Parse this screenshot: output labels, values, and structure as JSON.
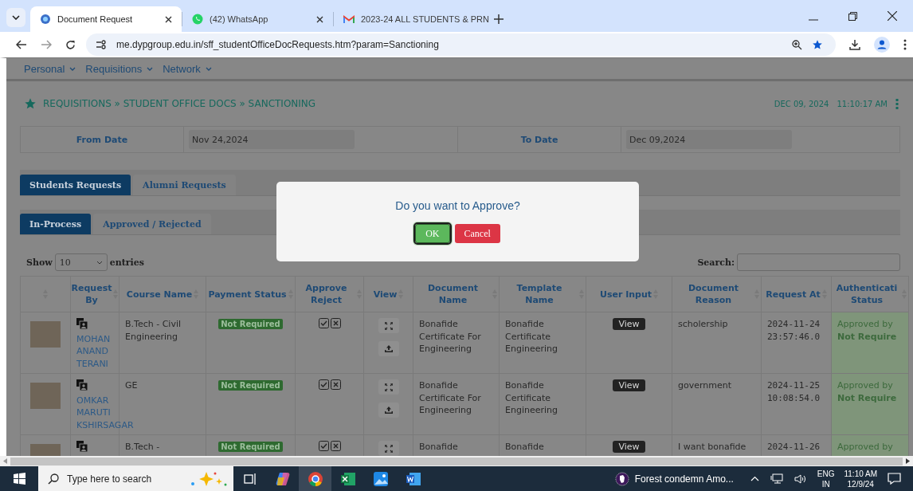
{
  "browser": {
    "tabs": [
      {
        "title": "Document Request",
        "kind": "site",
        "selected": true
      },
      {
        "title": "(42) WhatsApp",
        "kind": "whatsapp",
        "selected": false
      },
      {
        "title": "2023-24 ALL STUDENTS & PRN",
        "kind": "gmail",
        "selected": false
      }
    ],
    "url": "me.dypgroup.edu.in/sff_studentOfficeDocRequests.htm?param=Sanctioning"
  },
  "nav": [
    "Personal",
    "Requisitions",
    "Network"
  ],
  "breadcrumb": "REQUISITIONS » STUDENT OFFICE DOCS » SANCTIONING",
  "date": "DEC 09, 2024",
  "time": "11:10:17 AM",
  "filters": [
    {
      "label": "From Date",
      "value": "Nov 24,2024"
    },
    {
      "label": "To Date",
      "value": "Dec 09,2024"
    }
  ],
  "tabs": [
    {
      "label": "Students Requests",
      "selected": true
    },
    {
      "label": "Alumni Requests",
      "selected": false
    }
  ],
  "subtabs": [
    {
      "label": "In-Process",
      "selected": true
    },
    {
      "label": "Approved / Rejected",
      "selected": false
    }
  ],
  "show_label": "Show",
  "entries_value": "10",
  "entries_label": "entries",
  "search_label": "Search:",
  "table": {
    "columns": [
      "",
      "Request By",
      "Course Name",
      "Payment Status",
      "Approve Reject",
      "View",
      "Document Name",
      "Template Name",
      "User Input",
      "Document Reason",
      "Request At",
      "Authenticati Status"
    ],
    "rows": [
      {
        "name": "MOHAN ANAND TERANI",
        "course": "B.Tech - Civil Engineering",
        "payment": "Not Required",
        "downloadable": true,
        "document": "Bonafide Certificate For Engineering",
        "template": "Bonafide Certificate Engineering",
        "user_input": "View",
        "reason": "scholership",
        "request_at": "2024-11-24 23:57:46.0",
        "auth_label": "Approved by",
        "auth_value": "Not Require"
      },
      {
        "name": "OMKAR MARUTI KSHIRSAGAR",
        "course": "GE",
        "payment": "Not Required",
        "downloadable": true,
        "document": "Bonafide Certificate For Engineering",
        "template": "Bonafide Certificate Engineering",
        "user_input": "View",
        "reason": "government",
        "request_at": "2024-11-25 10:08:54.0",
        "auth_label": "Approved by",
        "auth_value": "Not Require"
      },
      {
        "course": "B.Tech -",
        "payment": "Not Required",
        "downloadable": false,
        "document": "Bonafide",
        "template": "Bonafide",
        "user_input": "View",
        "reason": "I want bonafide",
        "request_at": "2024-11-26",
        "auth_label": "Approved by"
      }
    ]
  },
  "dialog": {
    "message": "Do you want to Approve?",
    "buttons": [
      {
        "label": "OK",
        "kind": "primary"
      },
      {
        "label": "Cancel",
        "kind": "danger"
      }
    ]
  },
  "taskbar": {
    "search_placeholder": "Type here to search",
    "apps": [
      {
        "kind": "taskview",
        "selected": false
      },
      {
        "kind": "copilot",
        "selected": false
      },
      {
        "kind": "chrome",
        "selected": true
      },
      {
        "kind": "excel",
        "selected": false
      },
      {
        "kind": "photos",
        "selected": false
      },
      {
        "kind": "word",
        "selected": false
      }
    ],
    "news": "Forest condemn Amo...",
    "lang": "ENG",
    "region": "IN",
    "time": "11:10 AM",
    "date": "12/9/24"
  }
}
